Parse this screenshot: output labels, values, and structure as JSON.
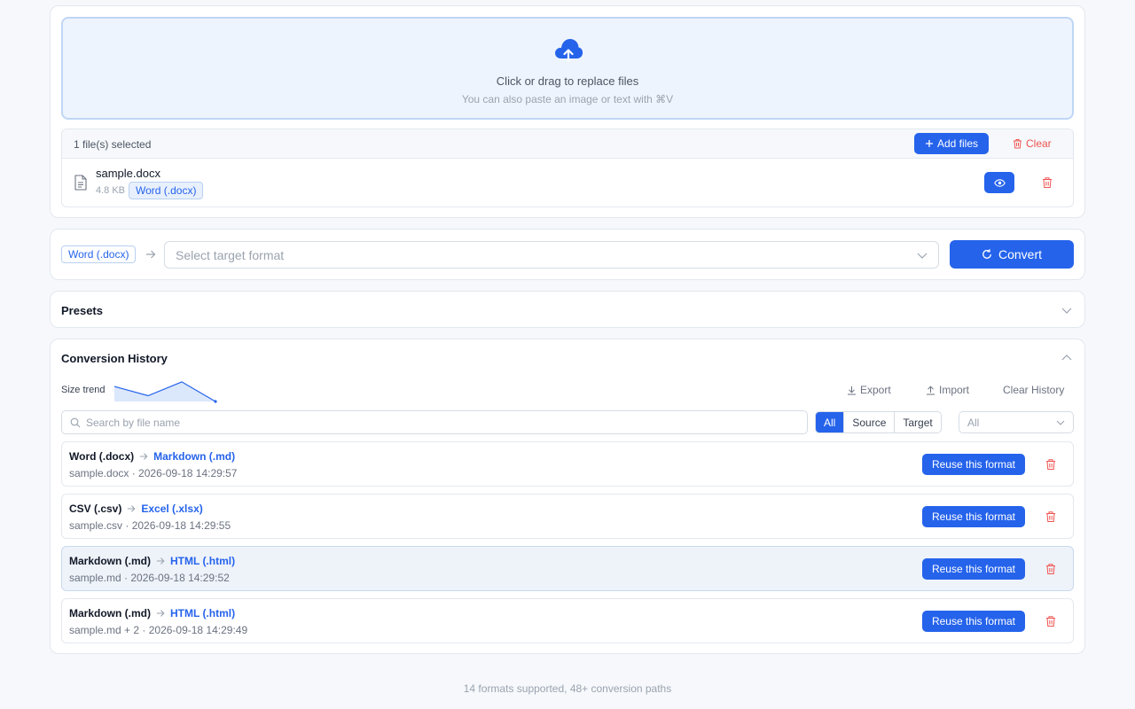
{
  "upload": {
    "primary_text": "Click or drag to replace files",
    "secondary_text": "You can also paste an image or text with ⌘V",
    "selected_count": "1 file(s) selected",
    "add_files_label": "Add files",
    "clear_label": "Clear",
    "file": {
      "name": "sample.docx",
      "size": "4.8 KB",
      "format": "Word (.docx)"
    }
  },
  "convert": {
    "source_format": "Word (.docx)",
    "target_placeholder": "Select target format",
    "button_label": "Convert"
  },
  "presets": {
    "title": "Presets"
  },
  "history": {
    "title": "Conversion History",
    "trend_label": "Size trend",
    "size_trend": [
      0.65,
      0.25,
      0.85,
      0.0
    ],
    "export_label": "Export",
    "import_label": "Import",
    "clear_label": "Clear History",
    "search_placeholder": "Search by file name",
    "filters": [
      "All",
      "Source",
      "Target"
    ],
    "active_filter": "All",
    "format_filter": "All",
    "reuse_label": "Reuse this format",
    "rows": [
      {
        "source": "Word (.docx)",
        "target": "Markdown (.md)",
        "file": "sample.docx",
        "time": "2026-09-18 14:29:57"
      },
      {
        "source": "CSV (.csv)",
        "target": "Excel (.xlsx)",
        "file": "sample.csv",
        "time": "2026-09-18 14:29:55"
      },
      {
        "source": "Markdown (.md)",
        "target": "HTML (.html)",
        "file": "sample.md",
        "time": "2026-09-18 14:29:52"
      },
      {
        "source": "Markdown (.md)",
        "target": "HTML (.html)",
        "file": "sample.md + 2",
        "time": "2026-09-18 14:29:49"
      }
    ]
  },
  "footer": {
    "text": "14 formats supported, 48+ conversion paths"
  },
  "colors": {
    "accent": "#2563eb",
    "danger": "#ef5350",
    "dropzone_bg": "#eef4fd",
    "page_bg": "#f6f8fb"
  }
}
